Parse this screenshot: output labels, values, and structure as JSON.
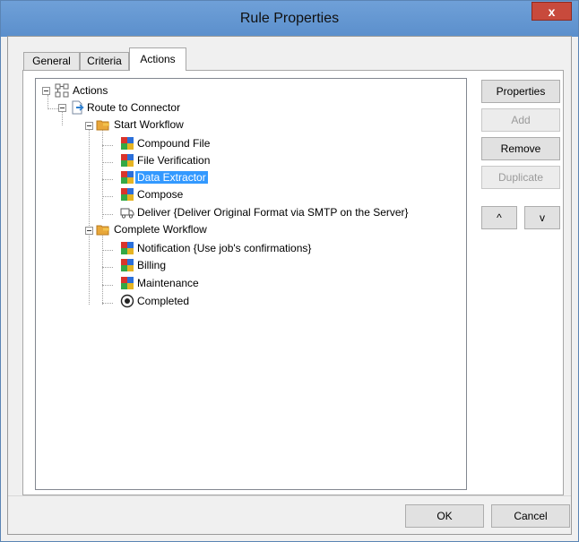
{
  "window": {
    "title": "Rule Properties",
    "close_glyph": "x"
  },
  "tabs": [
    {
      "label": "General"
    },
    {
      "label": "Criteria"
    },
    {
      "label": "Actions"
    }
  ],
  "tree": {
    "root": "Actions",
    "route": "Route to Connector",
    "start_workflow": "Start Workflow",
    "start_items": [
      "Compound File",
      "File Verification",
      "Data Extractor",
      "Compose",
      "Deliver {Deliver Original Format via SMTP on the Server}"
    ],
    "complete_workflow": "Complete Workflow",
    "complete_items": [
      "Notification {Use job's confirmations}",
      "Billing",
      "Maintenance",
      "Completed"
    ],
    "selected": "Data Extractor"
  },
  "side_buttons": {
    "properties": "Properties",
    "add": "Add",
    "remove": "Remove",
    "duplicate": "Duplicate",
    "up": "^",
    "down": "v"
  },
  "footer": {
    "ok": "OK",
    "cancel": "Cancel"
  },
  "colors": {
    "title_bar": "#5b8fcc",
    "selection": "#3399ff",
    "close": "#c84a3c"
  }
}
